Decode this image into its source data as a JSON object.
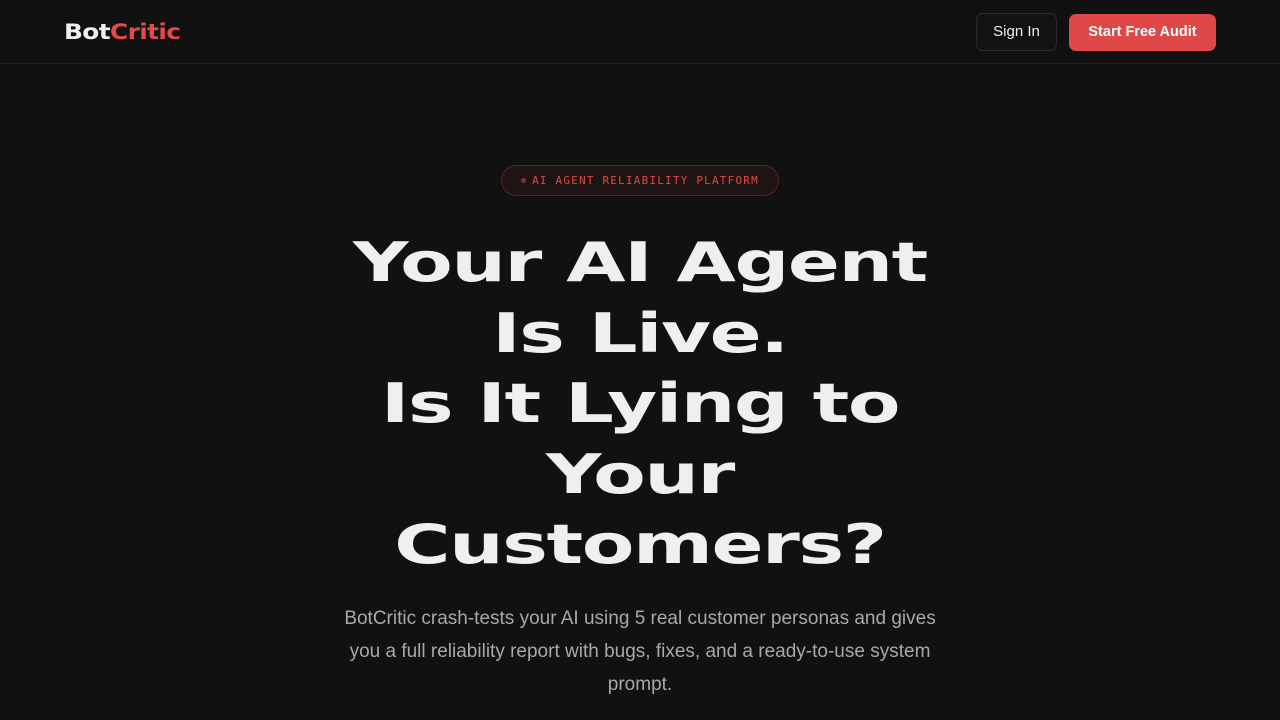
{
  "header": {
    "logo_part1": "Bot",
    "logo_part2": "Critic",
    "signin_label": "Sign In",
    "cta_label": "Start Free Audit"
  },
  "hero": {
    "badge_text": "AI AGENT RELIABILITY PLATFORM",
    "headline_lines": [
      "Your AI Agent",
      "Is Live.",
      "Is It Lying to",
      "Your",
      "Customers?"
    ],
    "subtitle": "BotCritic crash-tests your AI using 5 real customer personas and gives you a full reliability report with bugs, fixes, and a ready-to-use system prompt."
  },
  "colors": {
    "background": "#111111",
    "accent": "#e04848",
    "text": "#efefef",
    "muted": "#a8a8a8"
  }
}
